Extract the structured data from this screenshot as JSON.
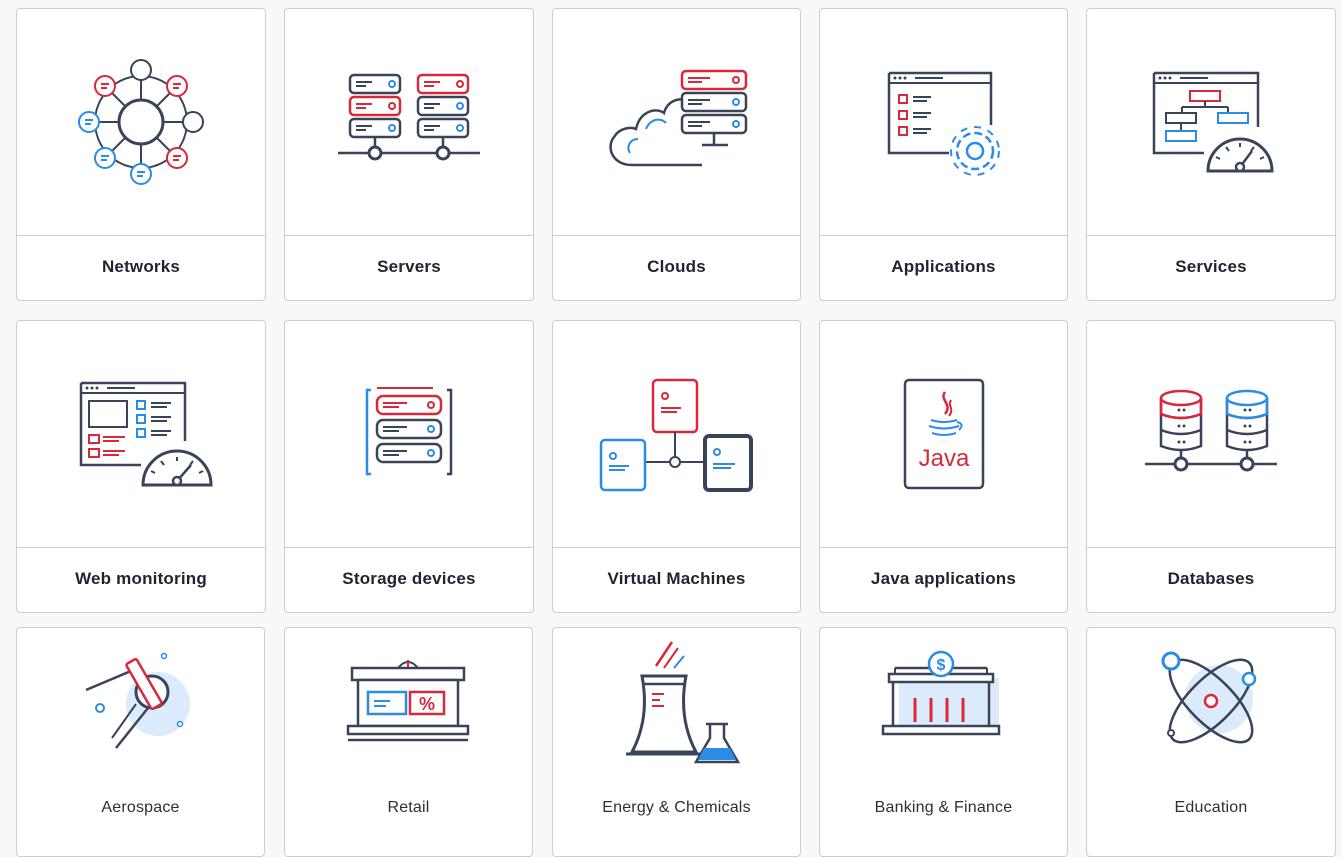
{
  "colors": {
    "navy": "#3a4459",
    "red": "#d7293a",
    "blue": "#2b8ce8",
    "lightblue": "#dcebfb",
    "border": "#c9ced6"
  },
  "rows": [
    {
      "cards": [
        {
          "label": "Networks",
          "icon": "network-icon"
        },
        {
          "label": "Servers",
          "icon": "servers-icon"
        },
        {
          "label": "Clouds",
          "icon": "cloud-icon"
        },
        {
          "label": "Applications",
          "icon": "applications-icon"
        },
        {
          "label": "Services",
          "icon": "services-icon"
        }
      ]
    },
    {
      "cards": [
        {
          "label": "Web monitoring",
          "icon": "web-monitoring-icon"
        },
        {
          "label": "Storage devices",
          "icon": "storage-icon"
        },
        {
          "label": "Virtual Machines",
          "icon": "virtual-machines-icon"
        },
        {
          "label": "Java applications",
          "icon": "java-icon",
          "icon_text": "Java"
        },
        {
          "label": "Databases",
          "icon": "databases-icon"
        }
      ]
    },
    {
      "cards": [
        {
          "label": "Aerospace",
          "icon": "satellite-icon"
        },
        {
          "label": "Retail",
          "icon": "store-icon",
          "icon_text": "%"
        },
        {
          "label": "Energy & Chemicals",
          "icon": "energy-icon"
        },
        {
          "label": "Banking & Finance",
          "icon": "bank-icon",
          "icon_text": "$"
        },
        {
          "label": "Education",
          "icon": "atom-icon"
        }
      ]
    }
  ]
}
